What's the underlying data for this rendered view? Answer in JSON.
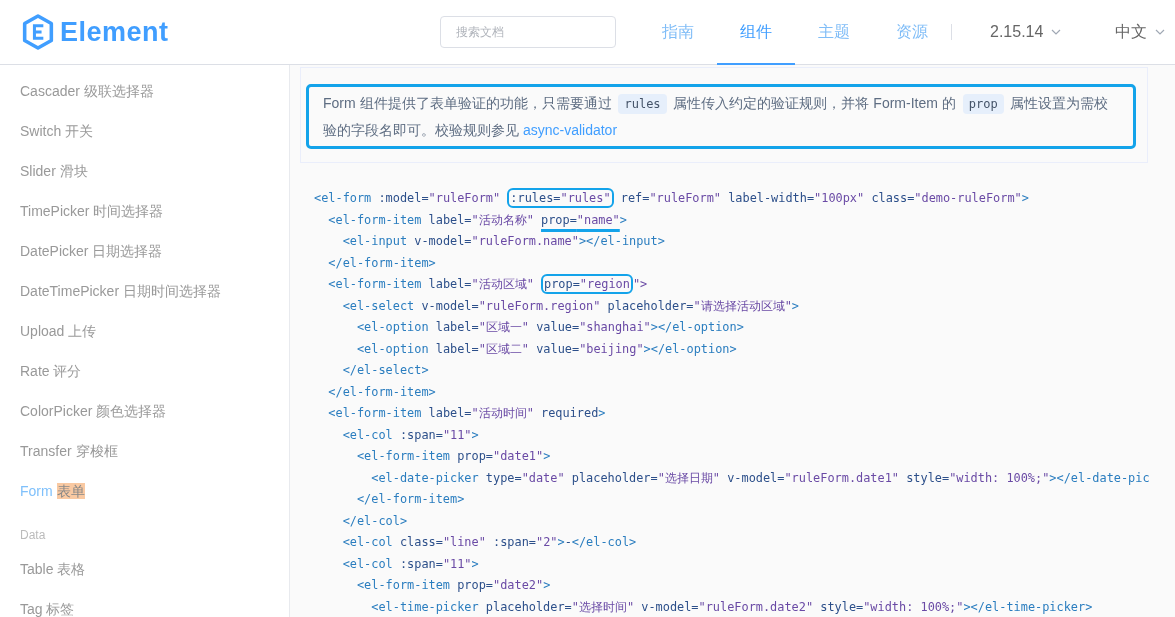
{
  "header": {
    "logo_text": "Element",
    "search": {
      "placeholder": "搜索文档"
    },
    "nav": [
      {
        "label": "指南",
        "selected": false
      },
      {
        "label": "组件",
        "selected": true
      },
      {
        "label": "主题",
        "selected": false
      },
      {
        "label": "资源",
        "selected": false
      }
    ],
    "version": "2.15.14",
    "language": "中文"
  },
  "sidebar": {
    "items": [
      {
        "kind": "link",
        "name": "Cascader",
        "title": "级联选择器",
        "selected": false,
        "highlighted": false
      },
      {
        "kind": "link",
        "name": "Switch",
        "title": "开关",
        "selected": false,
        "highlighted": false
      },
      {
        "kind": "link",
        "name": "Slider",
        "title": "滑块",
        "selected": false,
        "highlighted": false
      },
      {
        "kind": "link",
        "name": "TimePicker",
        "title": "时间选择器",
        "selected": false,
        "highlighted": false
      },
      {
        "kind": "link",
        "name": "DatePicker",
        "title": "日期选择器",
        "selected": false,
        "highlighted": false
      },
      {
        "kind": "link",
        "name": "DateTimePicker",
        "title": "日期时间选择器",
        "selected": false,
        "highlighted": false
      },
      {
        "kind": "link",
        "name": "Upload",
        "title": "上传",
        "selected": false,
        "highlighted": false
      },
      {
        "kind": "link",
        "name": "Rate",
        "title": "评分",
        "selected": false,
        "highlighted": false
      },
      {
        "kind": "link",
        "name": "ColorPicker",
        "title": "颜色选择器",
        "selected": false,
        "highlighted": false
      },
      {
        "kind": "link",
        "name": "Transfer",
        "title": "穿梭框",
        "selected": false,
        "highlighted": false
      },
      {
        "kind": "link",
        "name": "Form",
        "title": "表单",
        "selected": true,
        "highlighted": true
      },
      {
        "kind": "group",
        "name": "Data"
      },
      {
        "kind": "link",
        "name": "Table",
        "title": "表格",
        "selected": false,
        "highlighted": false
      },
      {
        "kind": "link",
        "name": "Tag",
        "title": "标签",
        "selected": false,
        "highlighted": false
      }
    ]
  },
  "tip": {
    "framed": true,
    "parts": [
      {
        "kind": "text",
        "text": "Form 组件提供了表单验证的功能，只需要通过 "
      },
      {
        "kind": "code",
        "text": "rules"
      },
      {
        "kind": "text",
        "text": " 属性传入约定的验证规则，并将 Form-Item 的 "
      },
      {
        "kind": "code",
        "text": "prop"
      },
      {
        "kind": "text",
        "text": " 属性设置为需校验的字段名即可。校验规则参见 "
      },
      {
        "kind": "link",
        "text": "async-validator"
      }
    ]
  },
  "code_lines": [
    [
      {
        "kind": "plain",
        "text": "<el-form :model=\"ruleForm\" "
      },
      {
        "kind": "boxed",
        "text": ":rules=\"rules\""
      },
      {
        "kind": "plain",
        "text": " ref=\"ruleForm\" label-width=\"100px\" class=\"demo-ruleForm\">"
      }
    ],
    [
      {
        "kind": "plain",
        "text": "  <el-form-item label=\"活动名称\" "
      },
      {
        "kind": "underlined",
        "text": "prop=\"name\""
      },
      {
        "kind": "plain",
        "text": ">"
      }
    ],
    [
      {
        "text": "    <el-input v-model=\"ruleForm.name\"></el-input>"
      }
    ],
    [
      {
        "text": "  </el-form-item>"
      }
    ],
    [
      {
        "kind": "plain",
        "text": "  <el-form-item label=\"活动区域\" "
      },
      {
        "kind": "boxed",
        "text": "prop=\"region"
      },
      {
        "kind": "plain",
        "text": "\">"
      }
    ],
    [
      {
        "text": "    <el-select v-model=\"ruleForm.region\" placeholder=\"请选择活动区域\">"
      }
    ],
    [
      {
        "text": "      <el-option label=\"区域一\" value=\"shanghai\"></el-option>"
      }
    ],
    [
      {
        "text": "      <el-option label=\"区域二\" value=\"beijing\"></el-option>"
      }
    ],
    [
      {
        "text": "    </el-select>"
      }
    ],
    [
      {
        "text": "  </el-form-item>"
      }
    ],
    [
      {
        "text": "  <el-form-item label=\"活动时间\" required>"
      }
    ],
    [
      {
        "text": "    <el-col :span=\"11\">"
      }
    ],
    [
      {
        "text": "      <el-form-item prop=\"date1\">"
      }
    ],
    [
      {
        "text": "        <el-date-picker type=\"date\" placeholder=\"选择日期\" v-model=\"ruleForm.date1\" style=\"width: 100%;\"></el-date-pic"
      }
    ],
    [
      {
        "text": "      </el-form-item>"
      }
    ],
    [
      {
        "text": "    </el-col>"
      }
    ],
    [
      {
        "text": "    <el-col class=\"line\" :span=\"2\">-</el-col>"
      }
    ],
    [
      {
        "text": "    <el-col :span=\"11\">"
      }
    ],
    [
      {
        "text": "      <el-form-item prop=\"date2\">"
      }
    ],
    [
      {
        "text": "        <el-time-picker placeholder=\"选择时间\" v-model=\"ruleForm.date2\" style=\"width: 100%;\"></el-time-picker>"
      }
    ]
  ]
}
